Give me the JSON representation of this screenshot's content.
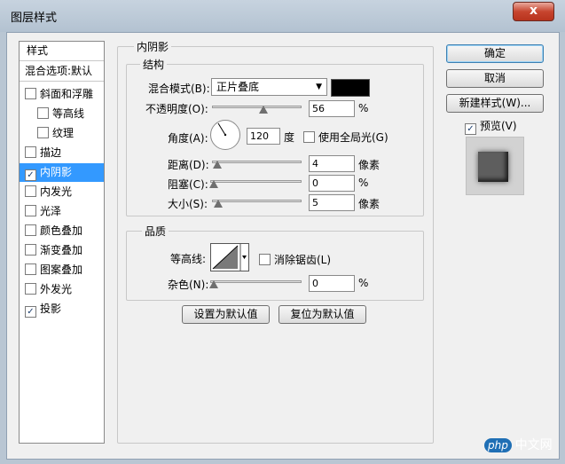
{
  "window": {
    "title": "图层样式",
    "close_label": "x"
  },
  "style_list": {
    "header": "样式",
    "blend_option": "混合选项:默认",
    "items": [
      {
        "label": "斜面和浮雕",
        "checked": false
      },
      {
        "label": "等高线",
        "checked": false
      },
      {
        "label": "纹理",
        "checked": false
      },
      {
        "label": "描边",
        "checked": false
      },
      {
        "label": "内阴影",
        "checked": true
      },
      {
        "label": "内发光",
        "checked": false
      },
      {
        "label": "光泽",
        "checked": false
      },
      {
        "label": "颜色叠加",
        "checked": false
      },
      {
        "label": "渐变叠加",
        "checked": false
      },
      {
        "label": "图案叠加",
        "checked": false
      },
      {
        "label": "外发光",
        "checked": false
      },
      {
        "label": "投影",
        "checked": true
      }
    ],
    "check_mark": "✓"
  },
  "inner_shadow": {
    "section_title": "内阴影",
    "structure": {
      "title": "结构",
      "blend_mode_label": "混合模式(B):",
      "blend_mode_value": "正片叠底",
      "shadow_color": "#000000",
      "opacity_label": "不透明度(O):",
      "opacity_value": "56",
      "opacity_unit": "%",
      "angle_label": "角度(A):",
      "angle_value": "120",
      "angle_unit": "度",
      "global_light_label": "使用全局光(G)",
      "global_light_checked": false,
      "distance_label": "距离(D):",
      "distance_value": "4",
      "distance_unit": "像素",
      "choke_label": "阻塞(C):",
      "choke_value": "0",
      "choke_unit": "%",
      "size_label": "大小(S):",
      "size_value": "5",
      "size_unit": "像素"
    },
    "quality": {
      "title": "品质",
      "contour_label": "等高线:",
      "antialias_label": "消除锯齿(L)",
      "antialias_checked": false,
      "noise_label": "杂色(N):",
      "noise_value": "0",
      "noise_unit": "%"
    },
    "make_default_label": "设置为默认值",
    "reset_default_label": "复位为默认值"
  },
  "actions": {
    "ok_label": "确定",
    "cancel_label": "取消",
    "new_style_label": "新建样式(W)...",
    "preview_label": "预览(V)",
    "preview_checked": true
  },
  "watermark": {
    "brand": "php",
    "site": "中文网"
  },
  "colors": {
    "selection": "#3399ff",
    "watermark_brand": "#1f6fb5"
  }
}
